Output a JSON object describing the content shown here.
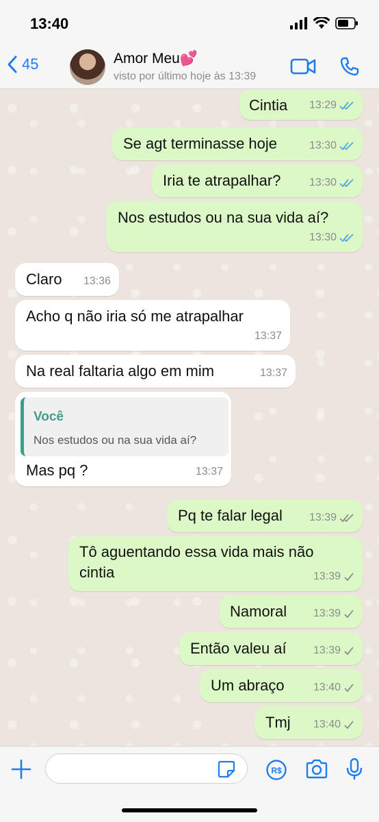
{
  "status_bar": {
    "time": "13:40"
  },
  "header": {
    "back_count": "45",
    "contact_name": "Amor Meu💕",
    "contact_status": "visto por último hoje às 13:39"
  },
  "messages": [
    {
      "dir": "out",
      "text": "Cintia",
      "time": "13:29",
      "status": "read"
    },
    {
      "dir": "out",
      "text": "Se agt terminasse hoje",
      "time": "13:30",
      "status": "read"
    },
    {
      "dir": "out",
      "text": "Iria te atrapalhar?",
      "time": "13:30",
      "status": "read"
    },
    {
      "dir": "out",
      "text": "Nos estudos ou na sua vida aí?",
      "time": "13:30",
      "status": "read"
    },
    {
      "dir": "in",
      "text": "Claro",
      "time": "13:36"
    },
    {
      "dir": "in",
      "text": "Acho q não iria só me atrapalhar",
      "time": "13:37"
    },
    {
      "dir": "in",
      "text": "Na real faltaria algo em mim",
      "time": "13:37"
    },
    {
      "dir": "in",
      "text": "Mas pq ?",
      "time": "13:37",
      "quote": {
        "author": "Você",
        "text": "Nos estudos ou na sua vida aí?"
      }
    },
    {
      "dir": "out",
      "text": "Pq te falar legal",
      "time": "13:39",
      "status": "delivered"
    },
    {
      "dir": "out",
      "text": "Tô aguentando essa vida mais não cintia",
      "time": "13:39",
      "status": "sent"
    },
    {
      "dir": "out",
      "text": "Namoral",
      "time": "13:39",
      "status": "sent"
    },
    {
      "dir": "out",
      "text": "Então valeu aí",
      "time": "13:39",
      "status": "sent"
    },
    {
      "dir": "out",
      "text": "Um abraço",
      "time": "13:40",
      "status": "sent"
    },
    {
      "dir": "out",
      "text": "Tmj",
      "time": "13:40",
      "status": "sent"
    }
  ],
  "composer": {
    "value": "",
    "pay_label": "R$"
  },
  "colors": {
    "accent": "#1e7cf2",
    "outgoing": "#dcf8c6",
    "incoming": "#ffffff",
    "read_tick": "#4fa6e8",
    "quote_bar": "#3f9d8a"
  },
  "icons": [
    "back-chevron-icon",
    "video-call-icon",
    "phone-icon",
    "plus-icon",
    "sticker-icon",
    "pay-icon",
    "camera-icon",
    "mic-icon",
    "signal-icon",
    "wifi-icon",
    "battery-icon"
  ]
}
